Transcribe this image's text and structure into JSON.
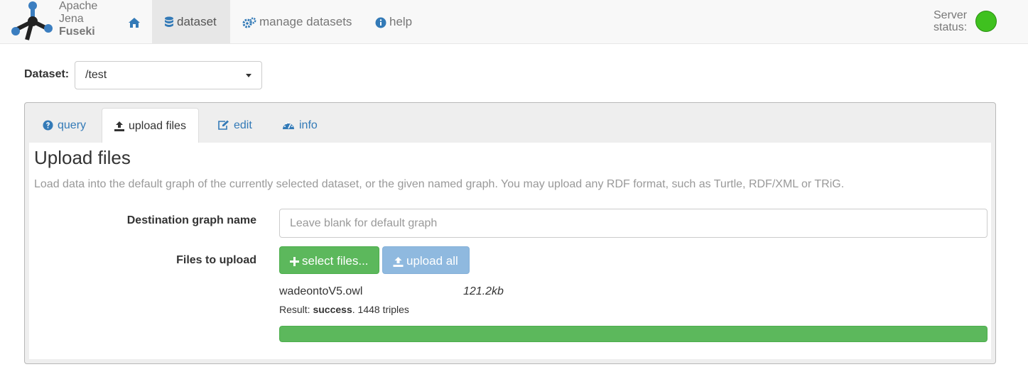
{
  "brand": {
    "line1": "Apache",
    "line2": "Jena",
    "line3": "Fuseki"
  },
  "nav": {
    "home_icon": "home-icon",
    "dataset": "dataset",
    "manage": "manage datasets",
    "help": "help"
  },
  "server_status": {
    "line1": "Server",
    "line2": "status:",
    "color": "#3fc11f"
  },
  "dataset": {
    "label": "Dataset:",
    "selected": "/test"
  },
  "tabs": [
    {
      "label": "query",
      "icon": "question-circle-icon"
    },
    {
      "label": "upload files",
      "icon": "upload-icon"
    },
    {
      "label": "edit",
      "icon": "edit-icon"
    },
    {
      "label": "info",
      "icon": "dashboard-icon"
    }
  ],
  "upload": {
    "title": "Upload files",
    "description": "Load data into the default graph of the currently selected dataset, or the given named graph. You may upload any RDF format, such as Turtle, RDF/XML or TRiG.",
    "graph_label": "Destination graph name",
    "graph_placeholder": "Leave blank for default graph",
    "files_label": "Files to upload",
    "select_button": "select files...",
    "upload_button": "upload all",
    "file": {
      "name": "wadeontoV5.owl",
      "size": "121.2kb",
      "result_prefix": "Result: ",
      "result_status": "success",
      "result_suffix": ". 1448 triples",
      "progress": 1.0
    }
  },
  "colors": {
    "link": "#337ab7",
    "success": "#5cb85c",
    "upload_disabled": "#8fb9df"
  }
}
